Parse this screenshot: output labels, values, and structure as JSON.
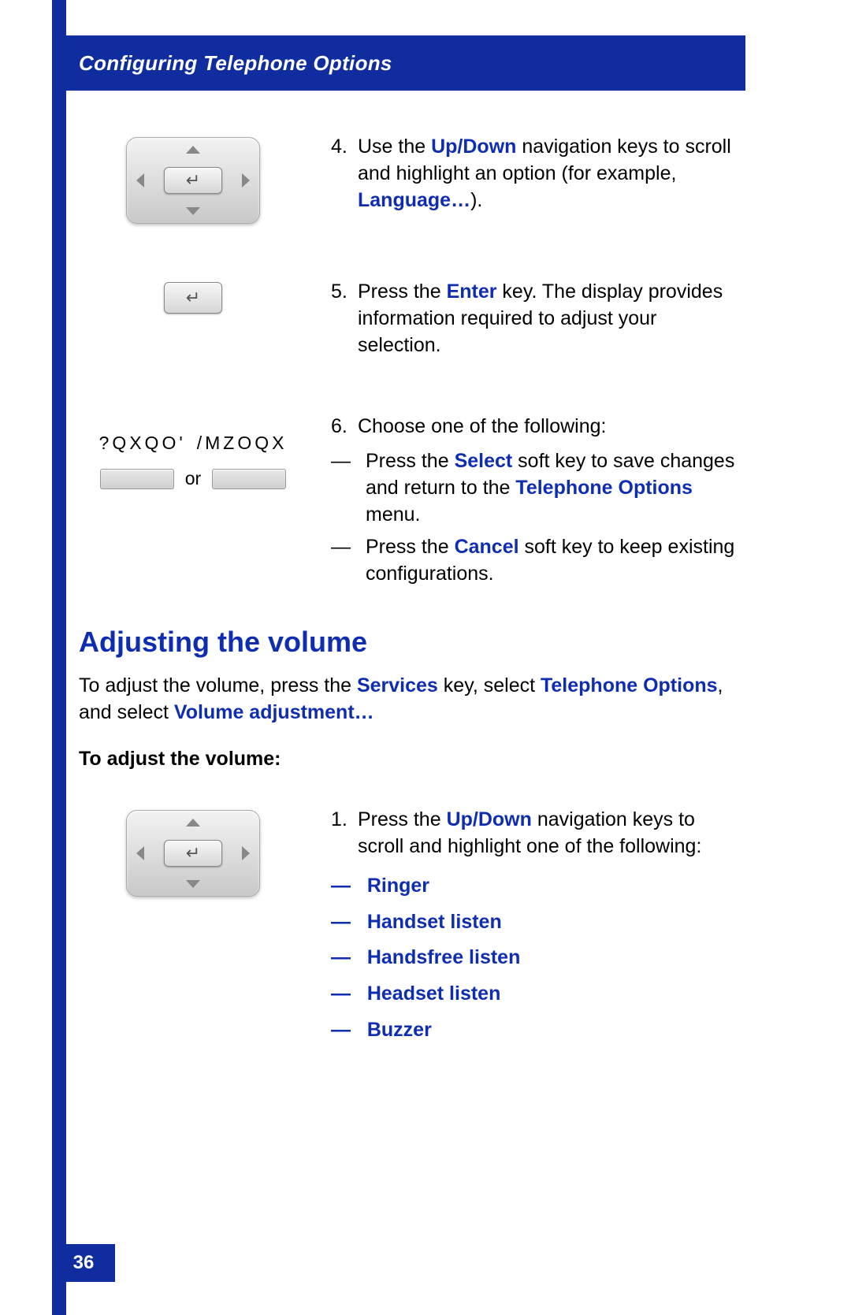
{
  "header": {
    "title": "Configuring Telephone Options"
  },
  "page_number": "36",
  "steps_top": {
    "s4": {
      "num": "4.",
      "pre": "Use the ",
      "hl1": "Up/Down",
      "mid": " navigation keys to scroll and highlight an option (for example, ",
      "hl2": "Language…",
      "post": ")."
    },
    "s5": {
      "num": "5.",
      "pre": "Press the ",
      "hl1": "Enter",
      "post": " key.  The display provides information required to adjust your selection."
    },
    "s6": {
      "num": "6.",
      "text": "Choose one of the following:",
      "softkeys": {
        "label_left": "?QXQO'",
        "label_right": "/MZOQX",
        "or": "or"
      },
      "opt_a": {
        "pre": "Press the ",
        "hl1": "Select",
        "mid": " soft key to save changes and return to the ",
        "hl2": "Telephone Options",
        "post": " menu."
      },
      "opt_b": {
        "pre": "Press the ",
        "hl1": "Cancel",
        "post": " soft key to keep existing configurations."
      }
    }
  },
  "section": {
    "title": "Adjusting the volume",
    "intro": {
      "pre": "To adjust the volume, press the ",
      "hl1": "Services",
      "mid1": " key, select ",
      "hl2": "Telephone Options",
      "mid2": ", and select ",
      "hl3": "Volume adjustment…"
    },
    "subhead": "To adjust the volume:",
    "s1": {
      "num": "1.",
      "pre": "Press the ",
      "hl1": "Up/Down",
      "post": " navigation keys to scroll and highlight one of the following:"
    },
    "options": {
      "a": "Ringer",
      "b": "Handset listen",
      "c": "Handsfree listen",
      "d": "Headset listen",
      "e": "Buzzer"
    }
  },
  "dash": "—"
}
